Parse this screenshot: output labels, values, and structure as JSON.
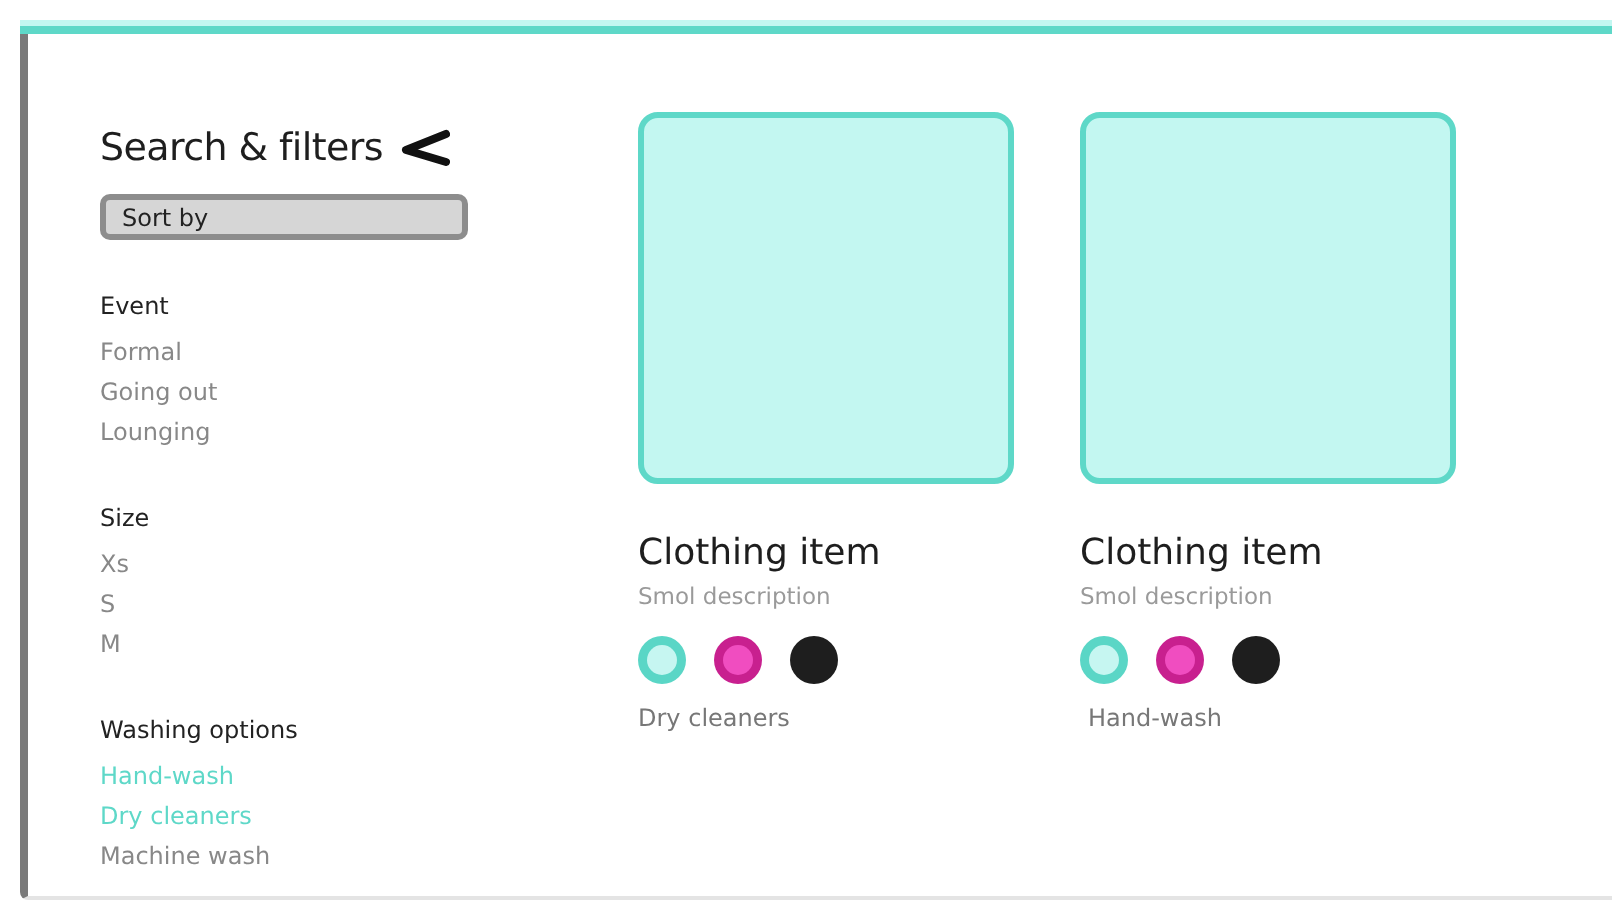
{
  "sidebar": {
    "title": "Search & filters",
    "sort": {
      "placeholder": "Sort by"
    },
    "groups": [
      {
        "heading": "Event",
        "items": [
          {
            "label": "Formal",
            "selected": false
          },
          {
            "label": "Going out",
            "selected": false
          },
          {
            "label": "Lounging",
            "selected": false
          }
        ]
      },
      {
        "heading": "Size",
        "items": [
          {
            "label": "Xs",
            "selected": false
          },
          {
            "label": "S",
            "selected": false
          },
          {
            "label": "M",
            "selected": false
          }
        ]
      },
      {
        "heading": "Washing options",
        "items": [
          {
            "label": "Hand-wash",
            "selected": true
          },
          {
            "label": "Dry cleaners",
            "selected": true
          },
          {
            "label": "Machine wash",
            "selected": false
          }
        ]
      }
    ]
  },
  "products": [
    {
      "title": "Clothing item",
      "description": "Smol description",
      "swatches": [
        {
          "color": "#5ad6c6",
          "selected": true
        },
        {
          "color": "#c8208f",
          "selected": true
        },
        {
          "color": "#1e1e1e",
          "selected": false
        }
      ],
      "washing": "Dry cleaners"
    },
    {
      "title": "Clothing item",
      "description": "Smol description",
      "swatches": [
        {
          "color": "#5ad6c6",
          "selected": true
        },
        {
          "color": "#c8208f",
          "selected": true
        },
        {
          "color": "#1e1e1e",
          "selected": false
        }
      ],
      "washing": "Hand-wash"
    }
  ]
}
